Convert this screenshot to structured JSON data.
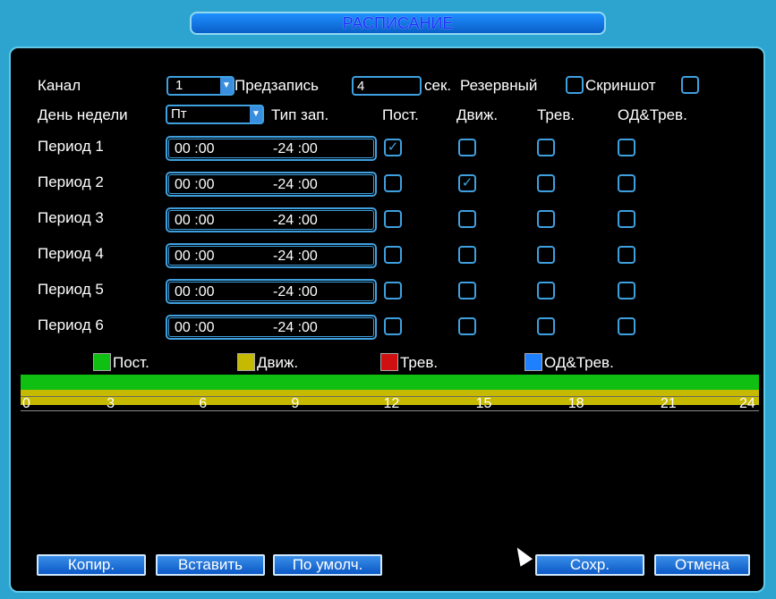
{
  "title": "РАСПИСАНИЕ",
  "top": {
    "channel_label": "Канал",
    "channel_value": "1",
    "prerecord_label": "Предзапись",
    "prerecord_value": "4",
    "sec_label": "сек.",
    "backup_label": "Резервный",
    "snapshot_label": "Скриншот"
  },
  "header": {
    "day_label": "День недели",
    "day_value": "Пт",
    "rec_type_label": "Тип зап.",
    "col_regular": "Пост.",
    "col_motion": "Движ.",
    "col_alarm": "Трев.",
    "col_md_alarm": "ОД&Трев."
  },
  "periods": [
    {
      "label": "Период 1",
      "start": "00 :00",
      "end": "-24 :00",
      "regular": true,
      "motion": false,
      "alarm": false,
      "md_alarm": false
    },
    {
      "label": "Период 2",
      "start": "00 :00",
      "end": "-24 :00",
      "regular": false,
      "motion": true,
      "alarm": false,
      "md_alarm": false
    },
    {
      "label": "Период 3",
      "start": "00 :00",
      "end": "-24 :00",
      "regular": false,
      "motion": false,
      "alarm": false,
      "md_alarm": false
    },
    {
      "label": "Период 4",
      "start": "00 :00",
      "end": "-24 :00",
      "regular": false,
      "motion": false,
      "alarm": false,
      "md_alarm": false
    },
    {
      "label": "Период 5",
      "start": "00 :00",
      "end": "-24 :00",
      "regular": false,
      "motion": false,
      "alarm": false,
      "md_alarm": false
    },
    {
      "label": "Период 6",
      "start": "00 :00",
      "end": "-24 :00",
      "regular": false,
      "motion": false,
      "alarm": false,
      "md_alarm": false
    }
  ],
  "legend": [
    {
      "label": "Пост.",
      "color": "#0fbf12"
    },
    {
      "label": "Движ.",
      "color": "#c6ba00"
    },
    {
      "label": "Трев.",
      "color": "#d01010"
    },
    {
      "label": "ОД&Трев.",
      "color": "#1e7fff"
    }
  ],
  "timeline": {
    "hours": [
      "0",
      "3",
      "6",
      "9",
      "12",
      "15",
      "18",
      "21",
      "24"
    ]
  },
  "buttons": {
    "copy": "Копир.",
    "paste": "Вставить",
    "default": "По умолч.",
    "save": "Сохр.",
    "cancel": "Отмена"
  },
  "colors": {
    "frame": "#2da3cf",
    "accent": "#3fa0e0",
    "title_text": "#1b2fff"
  }
}
